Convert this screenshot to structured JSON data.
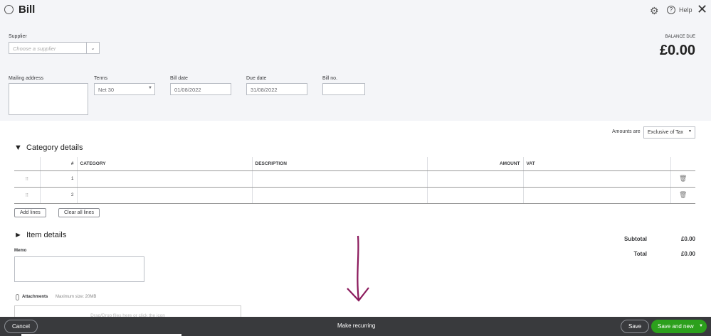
{
  "header": {
    "title": "Bill",
    "help": "Help",
    "balance_label": "BALANCE DUE",
    "balance": "£0.00"
  },
  "form": {
    "supplier_label": "Supplier",
    "supplier_placeholder": "Choose a supplier",
    "mailing_label": "Mailing address",
    "terms_label": "Terms",
    "terms_value": "Net 30",
    "bill_date_label": "Bill date",
    "bill_date": "01/08/2022",
    "due_date_label": "Due date",
    "due_date": "31/08/2022",
    "bill_no_label": "Bill no.",
    "bill_no": ""
  },
  "amounts": {
    "label": "Amounts are",
    "value": "Exclusive of Tax"
  },
  "category": {
    "title": "Category details",
    "headers": [
      "#",
      "CATEGORY",
      "DESCRIPTION",
      "AMOUNT",
      "VAT"
    ],
    "rows": [
      "1",
      "2"
    ],
    "add_lines": "Add lines",
    "clear_lines": "Clear all lines"
  },
  "item": {
    "title": "Item details"
  },
  "totals": {
    "subtotal_label": "Subtotal",
    "subtotal": "£0.00",
    "total_label": "Total",
    "total": "£0.00"
  },
  "memo": {
    "label": "Memo"
  },
  "attachments": {
    "label": "Attachments",
    "max": "Maximum size: 20MB",
    "drop": "Drag/Drop files here or click the icon"
  },
  "footer": {
    "cancel": "Cancel",
    "recurring": "Make recurring",
    "save": "Save",
    "save_new": "Save and new"
  },
  "colors": {
    "green": "#2ca01c",
    "annotation": "#8b1a5c",
    "footer": "#393a3d"
  }
}
